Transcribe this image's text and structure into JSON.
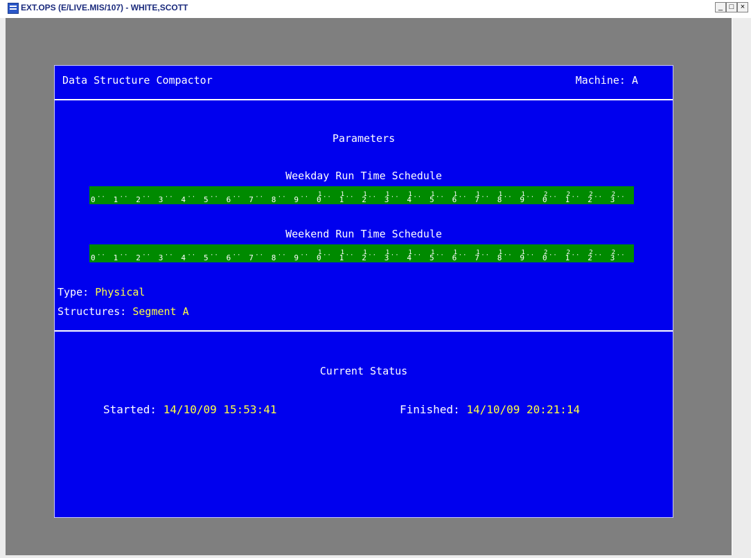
{
  "window": {
    "title": "EXT.OPS (E/LIVE.MIS/107) - WHITE,SCOTT",
    "minimize_label": "_",
    "maximize_label": "□",
    "close_label": "×"
  },
  "screen": {
    "title": "Data Structure Compactor",
    "machine_label": "Machine:",
    "machine_value": "A",
    "parameters_heading": "Parameters",
    "weekday_heading": "Weekday Run Time Schedule",
    "weekend_heading": "Weekend Run Time Schedule",
    "hours": [
      "0",
      "1",
      "2",
      "3",
      "4",
      "5",
      "6",
      "7",
      "8",
      "9",
      "0",
      "1",
      "2",
      "3",
      "4",
      "5",
      "6",
      "7",
      "8",
      "9",
      "0",
      "1",
      "2",
      "3"
    ],
    "hour_tens": [
      "",
      "",
      "",
      "",
      "",
      "",
      "",
      "",
      "",
      "",
      "1",
      "1",
      "1",
      "1",
      "1",
      "1",
      "1",
      "1",
      "1",
      "1",
      "2",
      "2",
      "2",
      "2"
    ],
    "type_label": "Type:",
    "type_value": "Physical",
    "structures_label": "Structures:",
    "structures_value": "Segment A",
    "status_heading": "Current Status",
    "started_label": "Started:",
    "started_value": "14/10/09 15:53:41",
    "finished_label": "Finished:",
    "finished_value": "14/10/09 20:21:14"
  },
  "colors": {
    "screen_bg": "#0000ee",
    "schedule_bar": "#008a00",
    "highlight_text": "#ffff44"
  }
}
